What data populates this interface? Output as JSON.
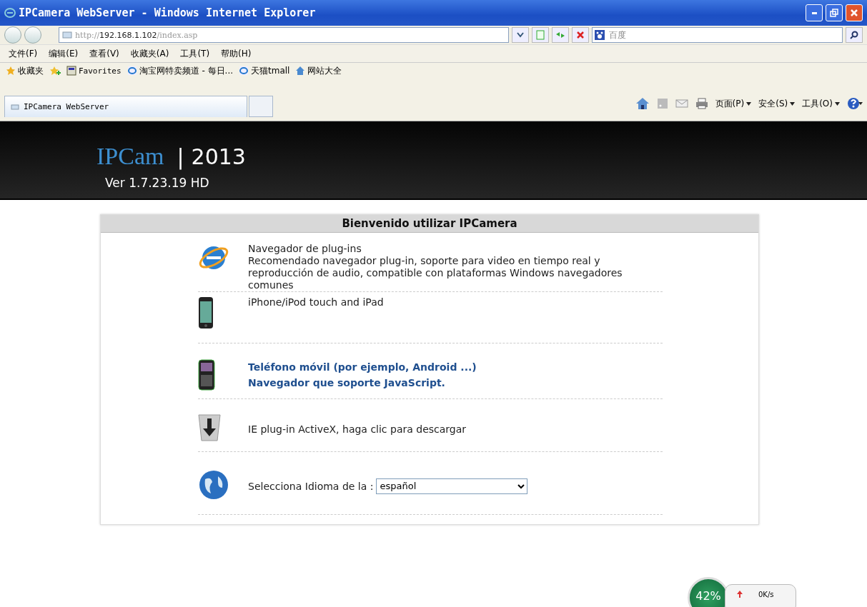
{
  "window": {
    "title": "IPCamera WebServer - Windows Internet Explorer"
  },
  "address_bar": {
    "scheme": "http://",
    "host": "192.168.1.102",
    "path": "/index.asp"
  },
  "search": {
    "placeholder": "百度"
  },
  "menu": [
    "文件(F)",
    "编辑(E)",
    "查看(V)",
    "收藏夹(A)",
    "工具(T)",
    "帮助(H)"
  ],
  "favorites_bar": {
    "label": "收藏夹",
    "items": [
      "Favorites",
      "淘宝网特卖频道 - 每日...",
      "天猫tmall",
      "网站大全"
    ]
  },
  "tabs": [
    {
      "label": "IPCamera WebServer",
      "selected": true
    }
  ],
  "command_bar": [
    "页面(P)",
    "安全(S)",
    "工具(O)"
  ],
  "page": {
    "logo": "IPCam",
    "separator": "|",
    "year": "2013",
    "version": "Ver 1.7.23.19 HD",
    "panel": {
      "title": "Bienvenido utilizar IPCamera",
      "rows": [
        {
          "kind": "plugin",
          "title": "Navegador de plug-ins",
          "text": "Recomendado navegador plug-in, soporte para video en tiempo real y reproducción de audio, compatible con plataformas Windows navegadores comunes"
        },
        {
          "kind": "iphone",
          "title": "iPhone/iPod touch and iPad"
        },
        {
          "kind": "mobile",
          "lines": [
            "Teléfono móvil (por ejemplo, Android ...)",
            "Navegador que soporte JavaScript."
          ]
        },
        {
          "kind": "download",
          "title": "IE plug-in ActiveX, haga clic para descargar"
        },
        {
          "kind": "language",
          "label": "Selecciona Idioma de la :",
          "value": "español"
        }
      ]
    }
  },
  "speed_widget": {
    "percent": "42%",
    "upload": "0K/s"
  }
}
